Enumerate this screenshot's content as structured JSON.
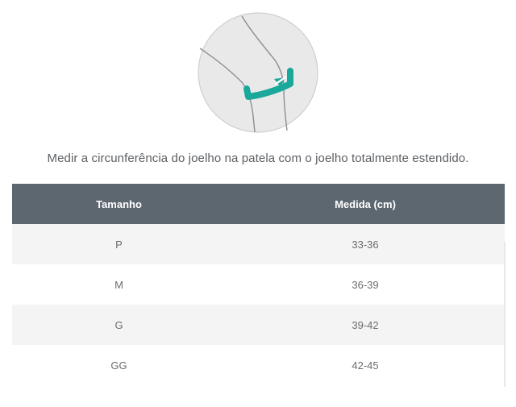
{
  "instruction": "Medir a circunferência do joelho na patela com o joelho totalmente estendido.",
  "table": {
    "headers": {
      "size": "Tamanho",
      "measure": "Medida (cm)"
    },
    "rows": [
      {
        "size": "P",
        "measure": "33-36"
      },
      {
        "size": "M",
        "measure": "36-39"
      },
      {
        "size": "G",
        "measure": "39-42"
      },
      {
        "size": "GG",
        "measure": "42-45"
      }
    ]
  },
  "colors": {
    "header_bg": "#5d6770",
    "row_alt_bg": "#f4f4f4",
    "arrow": "#1aa89a",
    "illustration_bg": "#e9e9ea",
    "text": "#5b5f63"
  },
  "icons": {
    "illustration": "knee-measurement-illustration",
    "arrow": "measuring-arrow-icon"
  }
}
